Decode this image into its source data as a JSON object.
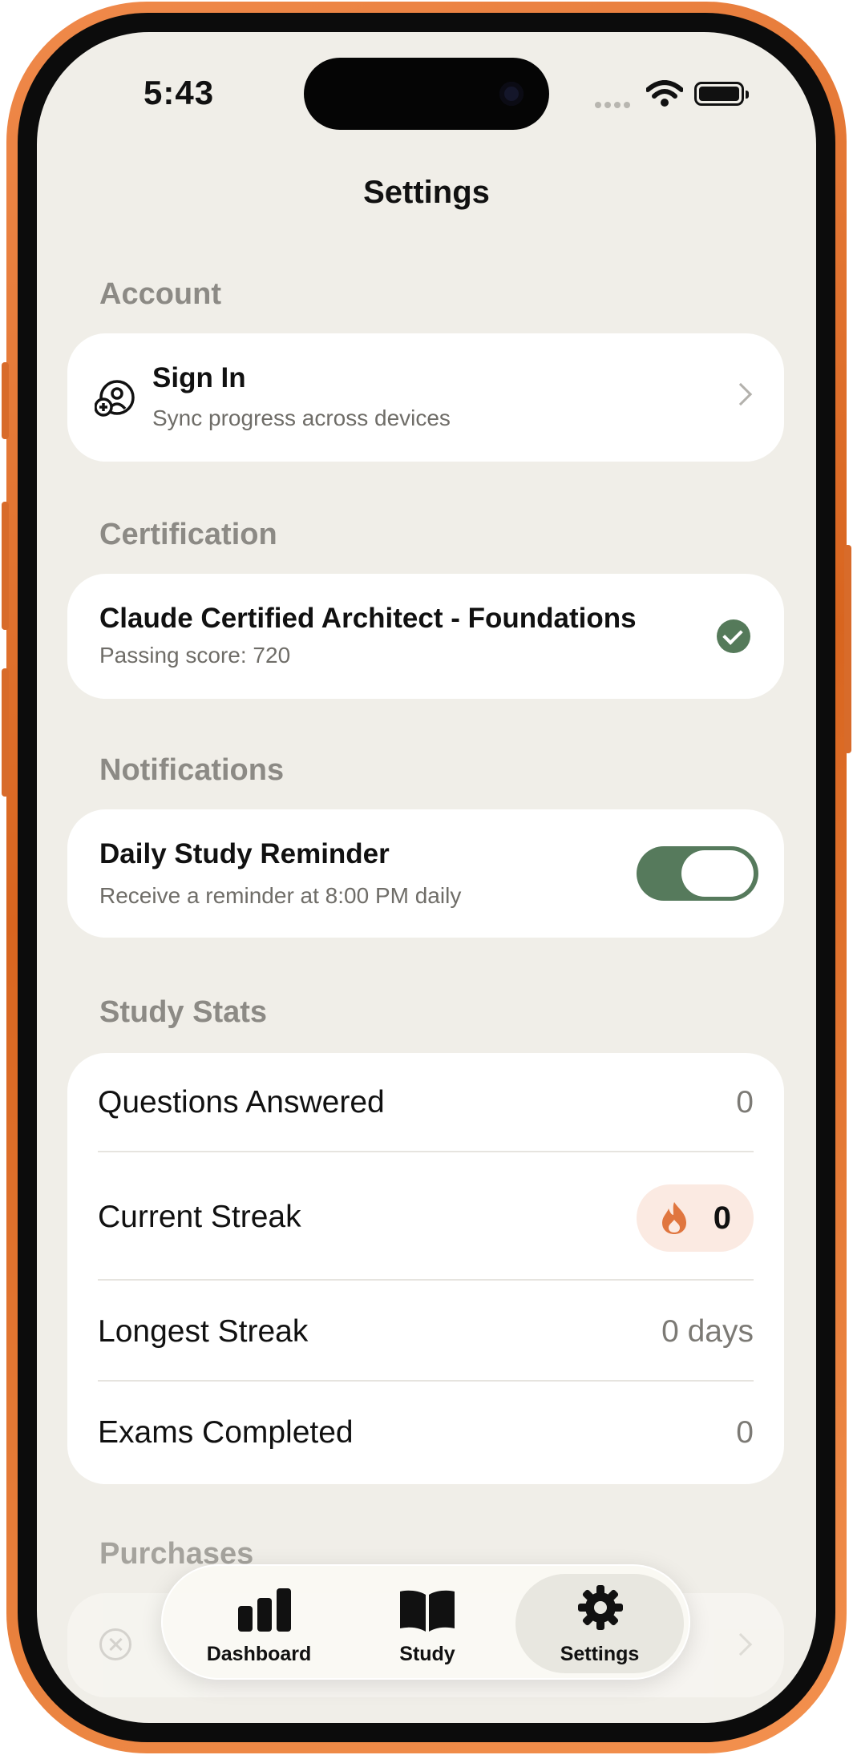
{
  "status_bar": {
    "time": "5:43"
  },
  "nav": {
    "title": "Settings"
  },
  "account": {
    "section_label": "Account",
    "sign_in_title": "Sign In",
    "sign_in_subtitle": "Sync progress across devices",
    "icon": "person-add-icon"
  },
  "certification": {
    "section_label": "Certification",
    "name": "Claude Certified Architect - Foundations",
    "passing_score": "Passing score: 720",
    "status_icon": "checkmark-circle-icon"
  },
  "notifications": {
    "section_label": "Notifications",
    "reminder_title": "Daily Study Reminder",
    "reminder_subtitle": "Receive a reminder at 8:00 PM daily",
    "reminder_enabled": true
  },
  "study_stats": {
    "section_label": "Study Stats",
    "rows": [
      {
        "label": "Questions Answered",
        "value": "0"
      },
      {
        "label": "Current Streak",
        "value": "0"
      },
      {
        "label": "Longest Streak",
        "value": "0 days"
      },
      {
        "label": "Exams Completed",
        "value": "0"
      }
    ]
  },
  "purchases": {
    "section_label": "Purchases"
  },
  "tabbar": {
    "tabs": [
      {
        "label": "Dashboard",
        "icon": "bar-chart-icon"
      },
      {
        "label": "Study",
        "icon": "book-icon"
      },
      {
        "label": "Settings",
        "icon": "gear-icon",
        "active": true
      }
    ]
  },
  "colors": {
    "accent_green": "#567a5c",
    "frame_orange": "#e0712c",
    "streak_flame": "#e0763f",
    "background": "#f0eee8"
  }
}
